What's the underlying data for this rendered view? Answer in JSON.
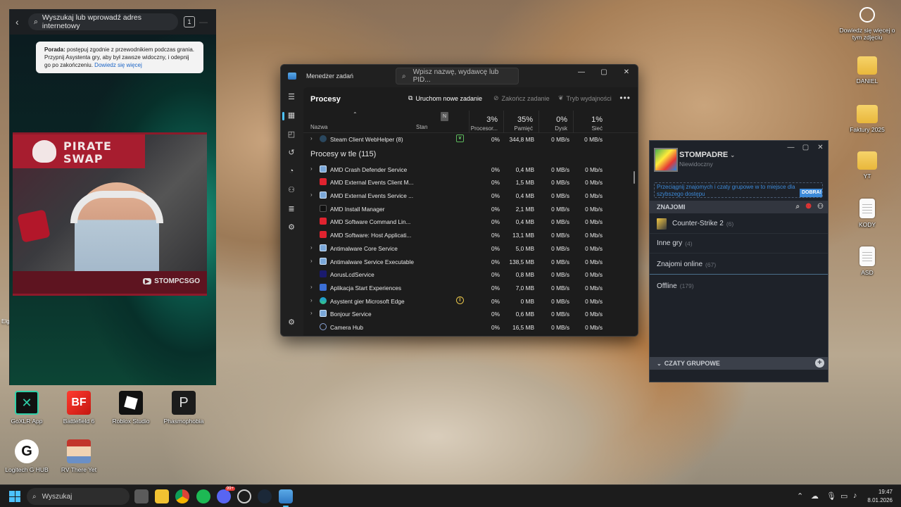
{
  "desktop": {
    "right_icons": [
      {
        "label": "Dowiedz się więcej o tym zdjęciu",
        "icon": "info-camera-icon"
      },
      {
        "label": "DANIEL",
        "icon": "folder-icon"
      },
      {
        "label": "Faktury 2025",
        "icon": "folder-icon"
      },
      {
        "label": "YT",
        "icon": "folder-icon"
      },
      {
        "label": "KODY",
        "icon": "document-icon"
      },
      {
        "label": "ASD",
        "icon": "document-icon"
      }
    ],
    "bottom_icons": [
      {
        "label": "GoXLR App",
        "icon": "goxlr-icon"
      },
      {
        "label": "Battlefield 6",
        "icon": "battlefield-icon"
      },
      {
        "label": "Roblox Studio",
        "icon": "roblox-icon"
      },
      {
        "label": "Phasmophobia",
        "icon": "phasmophobia-icon"
      },
      {
        "label": "Logitech G HUB",
        "icon": "logitech-icon"
      },
      {
        "label": "RV There Yet",
        "icon": "rv-icon"
      }
    ],
    "edge_left_label": "Elg"
  },
  "edge_panel": {
    "search_placeholder": "Wyszukaj lub wprowadź adres internetowy",
    "tab_count": "1",
    "tip_bold": "Porada:",
    "tip_text": " postępuj zgodnie z przewodnikiem podczas grania. Przypnij Asystenta gry, aby był zawsze widoczny, i odepnij go po zakończeniu.",
    "tip_link": "Dowiedz się więcej",
    "overlay_title_1": "PIRATE",
    "overlay_title_2": "SWAP",
    "overlay_channel": "STOMPCSGO"
  },
  "task_manager": {
    "title": "Menedżer zadań",
    "search_placeholder": "Wpisz nazwę, wydawcę lub PID...",
    "page_title": "Procesy",
    "actions": {
      "new_task": "Uruchom nowe zadanie",
      "end_task": "Zakończ zadanie",
      "efficiency": "Tryb wydajności"
    },
    "columns": {
      "name": "Nazwa",
      "status": "Stan",
      "status_badge": "N",
      "cpu_pct": "3%",
      "cpu": "Procesor...",
      "mem_pct": "35%",
      "mem": "Pamięć",
      "disk_pct": "0%",
      "disk": "Dysk",
      "net_pct": "1%",
      "net": "Sieć"
    },
    "top_row": {
      "name": "Steam Client WebHelper (8)",
      "cpu": "0%",
      "mem": "344,8 MB",
      "disk": "0 MB/s",
      "net": "0 MB/s",
      "expand": true,
      "icon": "steam",
      "status_icon": "efficiency-leaf-icon"
    },
    "section_title": "Procesy w tle (115)",
    "rows": [
      {
        "name": "AMD Crash Defender Service",
        "cpu": "0%",
        "mem": "0,4 MB",
        "disk": "0 MB/s",
        "net": "0 Mb/s",
        "expand": true,
        "icon": "service"
      },
      {
        "name": "AMD External Events Client M...",
        "cpu": "0%",
        "mem": "1,5 MB",
        "disk": "0 MB/s",
        "net": "0 Mb/s",
        "expand": false,
        "icon": "amd"
      },
      {
        "name": "AMD External Events Service ...",
        "cpu": "0%",
        "mem": "0,4 MB",
        "disk": "0 MB/s",
        "net": "0 Mb/s",
        "expand": true,
        "icon": "service"
      },
      {
        "name": "AMD Install Manager",
        "cpu": "0%",
        "mem": "2,1 MB",
        "disk": "0 MB/s",
        "net": "0 Mb/s",
        "expand": false,
        "icon": "amd-black"
      },
      {
        "name": "AMD Software Command Lin...",
        "cpu": "0%",
        "mem": "0,4 MB",
        "disk": "0 MB/s",
        "net": "0 Mb/s",
        "expand": false,
        "icon": "amd"
      },
      {
        "name": "AMD Software: Host Applicati...",
        "cpu": "0%",
        "mem": "13,1 MB",
        "disk": "0 MB/s",
        "net": "0 Mb/s",
        "expand": false,
        "icon": "amd"
      },
      {
        "name": "Antimalware Core Service",
        "cpu": "0%",
        "mem": "5,0 MB",
        "disk": "0 MB/s",
        "net": "0 Mb/s",
        "expand": true,
        "icon": "service"
      },
      {
        "name": "Antimalware Service Executable",
        "cpu": "0%",
        "mem": "138,5 MB",
        "disk": "0 MB/s",
        "net": "0 Mb/s",
        "expand": true,
        "icon": "service"
      },
      {
        "name": "AorusLcdService",
        "cpu": "0%",
        "mem": "0,8 MB",
        "disk": "0 MB/s",
        "net": "0 Mb/s",
        "expand": false,
        "icon": "aorus"
      },
      {
        "name": "Aplikacja Start Experiences",
        "cpu": "0%",
        "mem": "7,0 MB",
        "disk": "0 MB/s",
        "net": "0 Mb/s",
        "expand": true,
        "icon": "start"
      },
      {
        "name": "Asystent gier Microsoft Edge",
        "cpu": "0%",
        "mem": "0 MB",
        "disk": "0 MB/s",
        "net": "0 Mb/s",
        "expand": true,
        "icon": "edge",
        "status_icon": "paused-icon"
      },
      {
        "name": "Bonjour Service",
        "cpu": "0%",
        "mem": "0,6 MB",
        "disk": "0 MB/s",
        "net": "0 Mb/s",
        "expand": true,
        "icon": "service"
      },
      {
        "name": "Camera Hub",
        "cpu": "0%",
        "mem": "16,5 MB",
        "disk": "0 MB/s",
        "net": "0 Mb/s",
        "expand": false,
        "icon": "camera"
      }
    ]
  },
  "steam": {
    "username": "STOMPADRE",
    "status": "Niewidoczny",
    "prompt": "Przeciągnij znajomych i czaty grupowe w to miejsce dla szybszego dostępu",
    "prompt_button": "DOBRA!",
    "friends_header": "ZNAJOMI",
    "groups": [
      {
        "label": "Counter-Strike 2",
        "count": "(6)"
      },
      {
        "label": "Inne gry",
        "count": "(4)"
      },
      {
        "label": "Znajomi online",
        "count": "(67)"
      },
      {
        "label": "Offline",
        "count": "(179)"
      }
    ],
    "group_chats_header": "CZATY GRUPOWE"
  },
  "taskbar": {
    "search_placeholder": "Wyszukaj",
    "time": "19:47",
    "date": "8.01.2026",
    "discord_badge": "99+"
  }
}
